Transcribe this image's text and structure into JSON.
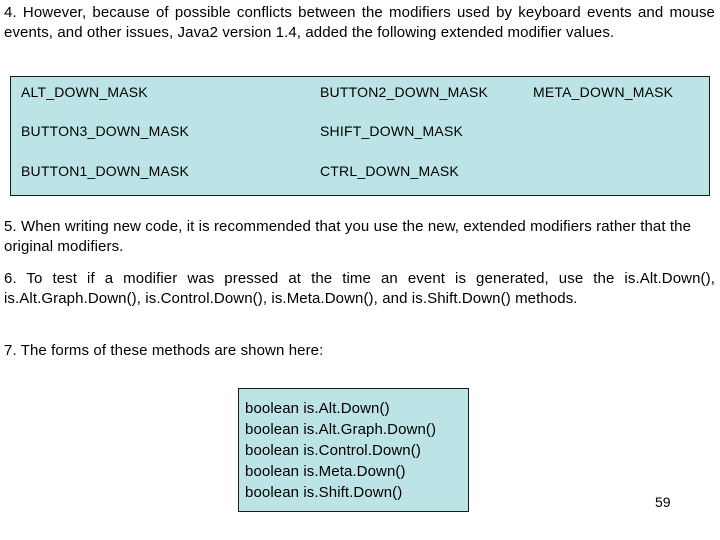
{
  "slide": {
    "page_number": "59",
    "accent_fill": "#bce3e5",
    "border_color": "#1b1b1b",
    "text_color": "#000000",
    "background": "#ffffff"
  },
  "paragraphs": {
    "p4": "4. However, because of possible conflicts between the modifiers used by keyboard events and mouse events, and other issues, Java2 version 1.4, added the following extended modifier values.",
    "p5": "5. When writing new code, it is recommended that you use the new, extended modifiers rather that the original modifiers.",
    "p6": "6. To test if a modifier was pressed at the time an event is generated, use the is.Alt.Down(), is.Alt.Graph.Down(), is.Control.Down(), is.Meta.Down(), and is.Shift.Down() methods.",
    "p7": "7. The forms of these methods are shown here:"
  },
  "mask_table": {
    "rows": [
      {
        "col1": "ALT_DOWN_MASK",
        "col2": "BUTTON2_DOWN_MASK",
        "col3": "META_DOWN_MASK"
      },
      {
        "col1": "BUTTON3_DOWN_MASK",
        "col2": "SHIFT_DOWN_MASK",
        "col3": ""
      },
      {
        "col1": "BUTTON1_DOWN_MASK",
        "col2": "CTRL_DOWN_MASK",
        "col3": ""
      }
    ]
  },
  "code_box": {
    "lines": [
      "boolean is.Alt.Down()",
      "boolean is.Alt.Graph.Down()",
      "boolean is.Control.Down()",
      "boolean is.Meta.Down()",
      "boolean is.Shift.Down()"
    ]
  }
}
